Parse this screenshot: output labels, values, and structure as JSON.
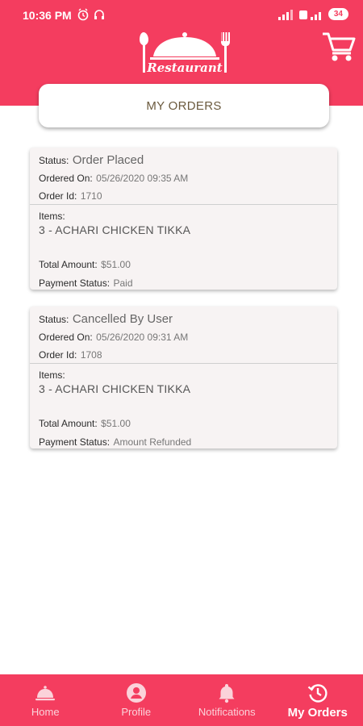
{
  "status_bar": {
    "time": "10:36 PM",
    "battery": "34"
  },
  "header": {
    "logo_text": "Restaurant",
    "cart_icon": "cart-icon"
  },
  "page_title": "MY ORDERS",
  "orders": [
    {
      "status_label": "Status:",
      "status": "Order Placed",
      "ordered_on_label": "Ordered On:",
      "ordered_on": "05/26/2020 09:35 AM",
      "order_id_label": "Order Id:",
      "order_id": "1710",
      "items_label": "Items:",
      "items": "3 - ACHARI CHICKEN TIKKA",
      "total_label": "Total Amount:",
      "total": "$51.00",
      "payment_label": "Payment Status:",
      "payment": "Paid"
    },
    {
      "status_label": "Status:",
      "status": "Cancelled By User",
      "ordered_on_label": "Ordered On:",
      "ordered_on": "05/26/2020 09:31 AM",
      "order_id_label": "Order Id:",
      "order_id": "1708",
      "items_label": "Items:",
      "items": "3 - ACHARI CHICKEN TIKKA",
      "total_label": "Total Amount:",
      "total": "$51.00",
      "payment_label": "Payment Status:",
      "payment": "Amount Refunded"
    }
  ],
  "bottom_nav": [
    {
      "label": "Home",
      "icon": "cloche-icon"
    },
    {
      "label": "Profile",
      "icon": "person-icon"
    },
    {
      "label": "Notifications",
      "icon": "bell-icon"
    },
    {
      "label": "My Orders",
      "icon": "history-icon",
      "active": true
    }
  ],
  "colors": {
    "brand": "#f43d5f",
    "card_bg": "#f7f3f3",
    "title_text": "#6b5a3e"
  }
}
